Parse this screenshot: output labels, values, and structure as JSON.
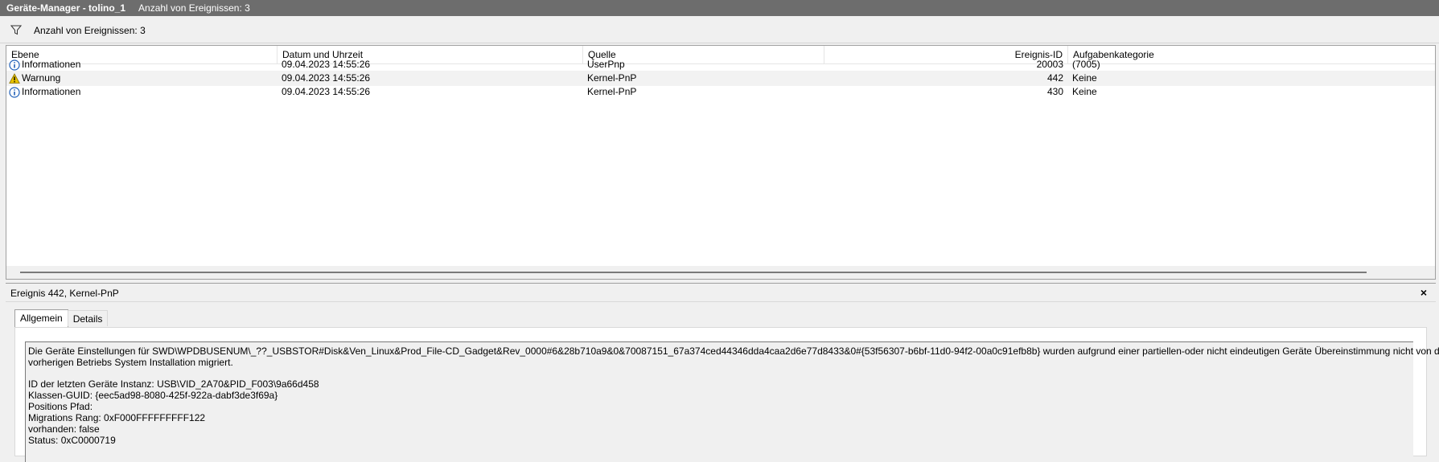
{
  "window": {
    "title": "Geräte-Manager - tolino_1",
    "subtitle": "Anzahl von Ereignissen: 3"
  },
  "filter": {
    "icon": "filter-icon",
    "text": "Anzahl von Ereignissen: 3"
  },
  "table": {
    "columns": [
      "Ebene",
      "Datum und Uhrzeit",
      "Quelle",
      "Ereignis-ID",
      "Aufgabenkategorie"
    ],
    "rows": [
      {
        "level": "Informationen",
        "icon": "info-icon",
        "datetime": "09.04.2023 14:55:26",
        "source": "UserPnp",
        "event_id": "20003",
        "category": "(7005)"
      },
      {
        "level": "Warnung",
        "icon": "warning-icon",
        "datetime": "09.04.2023 14:55:26",
        "source": "Kernel-PnP",
        "event_id": "442",
        "category": "Keine"
      },
      {
        "level": "Informationen",
        "icon": "info-icon",
        "datetime": "09.04.2023 14:55:26",
        "source": "Kernel-PnP",
        "event_id": "430",
        "category": "Keine"
      }
    ]
  },
  "detail": {
    "title": "Ereignis 442, Kernel-PnP",
    "close_label": "×",
    "tabs": [
      "Allgemein",
      "Details"
    ],
    "message_lines": [
      "Die Geräte Einstellungen für SWD\\WPDBUSENUM\\_??_USBSTOR#Disk&Ven_Linux&Prod_File-CD_Gadget&Rev_0000#6&28b710a9&0&70087151_67a374ced44346dda4caa2d6e77d8433&0#{53f56307-b6bf-11d0-94f2-00a0c91efb8b} wurden aufgrund einer partiellen-oder nicht eindeutigen Geräte Übereinstimmung nicht von der",
      "vorherigen Betriebs System Installation migriert.",
      "",
      "ID der letzten Geräte Instanz:  USB\\VID_2A70&PID_F003\\9a66d458",
      "Klassen-GUID:  {eec5ad98-8080-425f-922a-dabf3de3f69a}",
      "Positions Pfad:",
      "Migrations Rang:  0xF000FFFFFFFFF122",
      "vorhanden:  false",
      "Status:  0xC0000719"
    ]
  },
  "colors": {
    "titlebar": "#6d6d6d",
    "background": "#f0f0f0",
    "info_icon": "#1f5fb8",
    "warning_icon": "#e8c300"
  }
}
